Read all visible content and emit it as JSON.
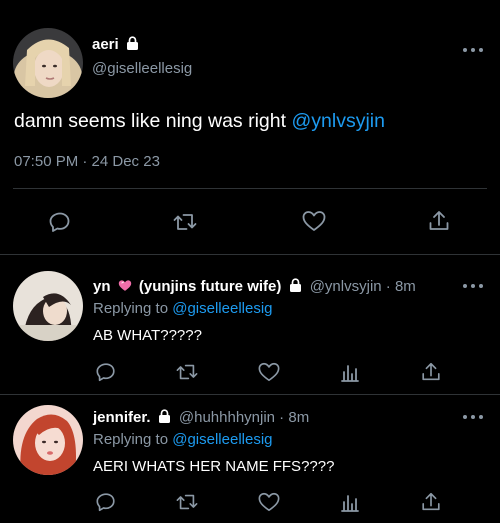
{
  "main_tweet": {
    "name": "aeri",
    "handle": "@giselleellesig",
    "text": "damn seems like ning was right ",
    "mention": "@ynlvsyjin",
    "meta": "07:50 PM · 24 Dec 23",
    "actions": [
      "reply-icon",
      "retweet-icon",
      "like-icon",
      "share-icon"
    ]
  },
  "replies": [
    {
      "name": "yn",
      "name_suffix": " (yunjins future wife)",
      "emoji": "heart-emoji",
      "handle": "@ynlvsyjin",
      "time": "8m",
      "replying_label": "Replying to ",
      "replying_to": "@giselleellesig",
      "text": "AB WHAT?????"
    },
    {
      "name": "jennifer.",
      "handle": "@huhhhhynjin",
      "time": "8m",
      "replying_label": "Replying to ",
      "replying_to": "@giselleellesig",
      "text": "AERI WHATS HER NAME FFS????"
    }
  ],
  "colors": {
    "accent": "#1d9bf0",
    "secondary": "#8b98a5",
    "divider": "#2f3336"
  }
}
